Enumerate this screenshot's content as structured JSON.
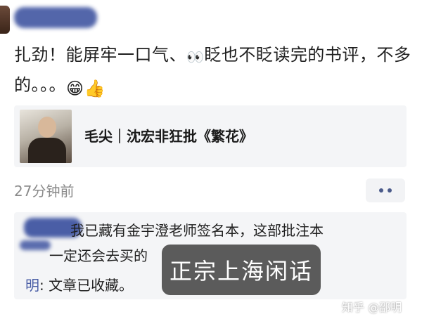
{
  "post": {
    "text_main": "扎劲！能屏牢一口气、",
    "eyes_emoji": "👀",
    "text_rest": "眨也不眨读完的书评，不多的。。。",
    "emoji_grin": "😁",
    "emoji_thumb": "👍"
  },
  "share_card": {
    "title": "毛尖｜沈宏非狂批《繁花》"
  },
  "timestamp": "27分钟前",
  "comments": {
    "line1": "我已藏有金宇澄老师签名本，这部批注本",
    "line2": "一定还会去买的",
    "reply_name": "明",
    "reply_text": ": 文章已收藏。"
  },
  "overlay_caption": "正宗上海闲话",
  "watermark": "知乎 @邵明"
}
